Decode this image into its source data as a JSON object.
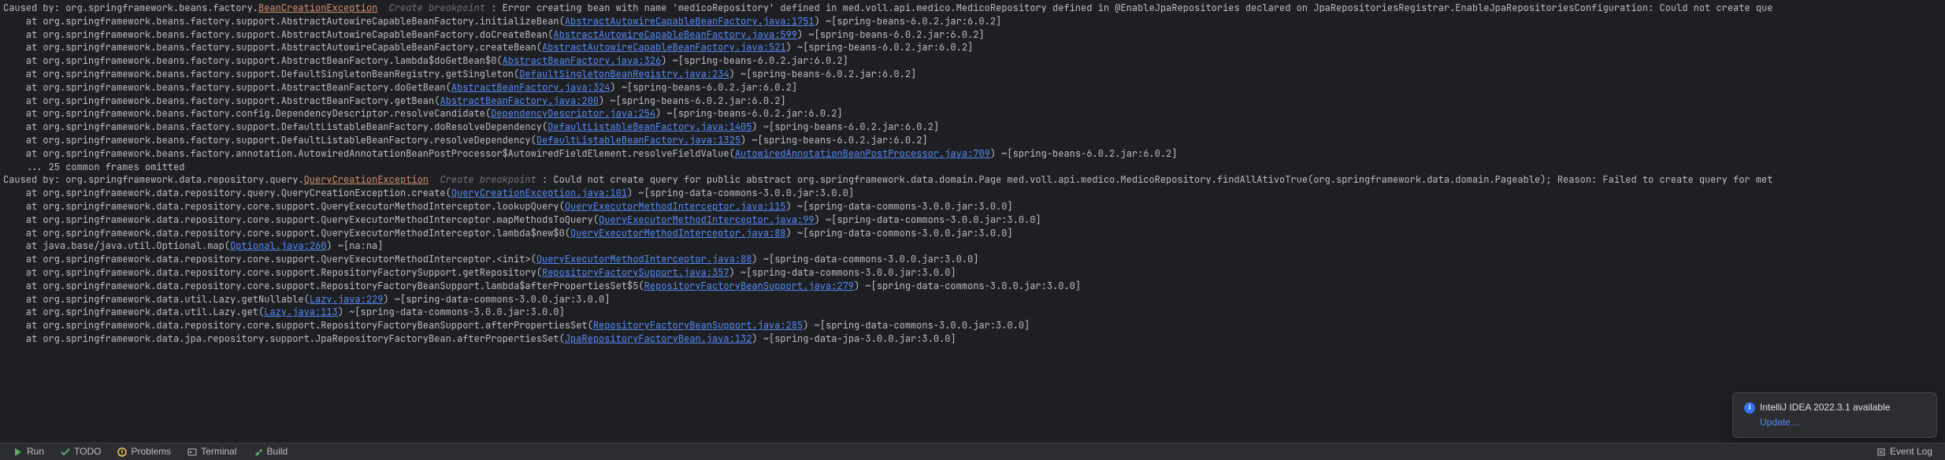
{
  "stack1": {
    "caused_by_prefix": "Caused by: ",
    "caused_by_pkg": "org.springframework.beans.factory.",
    "exception": "BeanCreationException",
    "breakpoint": "Create breakpoint",
    "message_tail": " : Error creating bean with name 'medicoRepository' defined in med.voll.api.medico.MedicoRepository defined in @EnableJpaRepositories declared on JpaRepositoriesRegistrar.EnableJpaRepositoriesConfiguration: Could not create que",
    "frames": [
      {
        "pre": "    at org.springframework.beans.factory.support.AbstractAutowireCapableBeanFactory.initializeBean(",
        "link": "AbstractAutowireCapableBeanFactory.java:1751",
        "post": ") ~[spring-beans-6.0.2.jar:6.0.2]"
      },
      {
        "pre": "    at org.springframework.beans.factory.support.AbstractAutowireCapableBeanFactory.doCreateBean(",
        "link": "AbstractAutowireCapableBeanFactory.java:599",
        "post": ") ~[spring-beans-6.0.2.jar:6.0.2]"
      },
      {
        "pre": "    at org.springframework.beans.factory.support.AbstractAutowireCapableBeanFactory.createBean(",
        "link": "AbstractAutowireCapableBeanFactory.java:521",
        "post": ") ~[spring-beans-6.0.2.jar:6.0.2]"
      },
      {
        "pre": "    at org.springframework.beans.factory.support.AbstractBeanFactory.lambda$doGetBean$0(",
        "link": "AbstractBeanFactory.java:326",
        "post": ") ~[spring-beans-6.0.2.jar:6.0.2]"
      },
      {
        "pre": "    at org.springframework.beans.factory.support.DefaultSingletonBeanRegistry.getSingleton(",
        "link": "DefaultSingletonBeanRegistry.java:234",
        "post": ") ~[spring-beans-6.0.2.jar:6.0.2]"
      },
      {
        "pre": "    at org.springframework.beans.factory.support.AbstractBeanFactory.doGetBean(",
        "link": "AbstractBeanFactory.java:324",
        "post": ") ~[spring-beans-6.0.2.jar:6.0.2]"
      },
      {
        "pre": "    at org.springframework.beans.factory.support.AbstractBeanFactory.getBean(",
        "link": "AbstractBeanFactory.java:200",
        "post": ") ~[spring-beans-6.0.2.jar:6.0.2]"
      },
      {
        "pre": "    at org.springframework.beans.factory.config.DependencyDescriptor.resolveCandidate(",
        "link": "DependencyDescriptor.java:254",
        "post": ") ~[spring-beans-6.0.2.jar:6.0.2]"
      },
      {
        "pre": "    at org.springframework.beans.factory.support.DefaultListableBeanFactory.doResolveDependency(",
        "link": "DefaultListableBeanFactory.java:1405",
        "post": ") ~[spring-beans-6.0.2.jar:6.0.2]"
      },
      {
        "pre": "    at org.springframework.beans.factory.support.DefaultListableBeanFactory.resolveDependency(",
        "link": "DefaultListableBeanFactory.java:1325",
        "post": ") ~[spring-beans-6.0.2.jar:6.0.2]"
      },
      {
        "pre": "    at org.springframework.beans.factory.annotation.AutowiredAnnotationBeanPostProcessor$AutowiredFieldElement.resolveFieldValue(",
        "link": "AutowiredAnnotationBeanPostProcessor.java:709",
        "post": ") ~[spring-beans-6.0.2.jar:6.0.2]"
      }
    ],
    "omitted": "    ... 25 common frames omitted"
  },
  "stack2": {
    "caused_by_prefix": "Caused by: ",
    "caused_by_pkg": "org.springframework.data.repository.query.",
    "exception": "QueryCreationException",
    "breakpoint": "Create breakpoint",
    "message_tail": " : Could not create query for public abstract org.springframework.data.domain.Page med.voll.api.medico.MedicoRepository.findAllAtivoTrue(org.springframework.data.domain.Pageable); Reason: Failed to create query for met",
    "frames": [
      {
        "pre": "    at org.springframework.data.repository.query.QueryCreationException.create(",
        "link": "QueryCreationException.java:101",
        "post": ") ~[spring-data-commons-3.0.0.jar:3.0.0]"
      },
      {
        "pre": "    at org.springframework.data.repository.core.support.QueryExecutorMethodInterceptor.lookupQuery(",
        "link": "QueryExecutorMethodInterceptor.java:115",
        "post": ") ~[spring-data-commons-3.0.0.jar:3.0.0]"
      },
      {
        "pre": "    at org.springframework.data.repository.core.support.QueryExecutorMethodInterceptor.mapMethodsToQuery(",
        "link": "QueryExecutorMethodInterceptor.java:99",
        "post": ") ~[spring-data-commons-3.0.0.jar:3.0.0]"
      },
      {
        "pre": "    at org.springframework.data.repository.core.support.QueryExecutorMethodInterceptor.lambda$new$0(",
        "link": "QueryExecutorMethodInterceptor.java:88",
        "post": ") ~[spring-data-commons-3.0.0.jar:3.0.0]"
      },
      {
        "pre": "    at java.base/java.util.Optional.map(",
        "link": "Optional.java:260",
        "post": ") ~[na:na]"
      },
      {
        "pre": "    at org.springframework.data.repository.core.support.QueryExecutorMethodInterceptor.<init>(",
        "link": "QueryExecutorMethodInterceptor.java:88",
        "post": ") ~[spring-data-commons-3.0.0.jar:3.0.0]"
      },
      {
        "pre": "    at org.springframework.data.repository.core.support.RepositoryFactorySupport.getRepository(",
        "link": "RepositoryFactorySupport.java:357",
        "post": ") ~[spring-data-commons-3.0.0.jar:3.0.0]"
      },
      {
        "pre": "    at org.springframework.data.repository.core.support.RepositoryFactoryBeanSupport.lambda$afterPropertiesSet$5(",
        "link": "RepositoryFactoryBeanSupport.java:279",
        "post": ") ~[spring-data-commons-3.0.0.jar:3.0.0]"
      },
      {
        "pre": "    at org.springframework.data.util.Lazy.getNullable(",
        "link": "Lazy.java:229",
        "post": ") ~[spring-data-commons-3.0.0.jar:3.0.0]"
      },
      {
        "pre": "    at org.springframework.data.util.Lazy.get(",
        "link": "Lazy.java:113",
        "post": ") ~[spring-data-commons-3.0.0.jar:3.0.0]"
      },
      {
        "pre": "    at org.springframework.data.repository.core.support.RepositoryFactoryBeanSupport.afterPropertiesSet(",
        "link": "RepositoryFactoryBeanSupport.java:285",
        "post": ") ~[spring-data-commons-3.0.0.jar:3.0.0]"
      },
      {
        "pre": "    at org.springframework.data.jpa.repository.support.JpaRepositoryFactoryBean.afterPropertiesSet(",
        "link": "JpaRepositoryFactoryBean.java:132",
        "post": ") ~[spring-data-jpa-3.0.0.jar:3.0.0]"
      }
    ]
  },
  "bottom": {
    "run": "Run",
    "todo": "TODO",
    "problems": "Problems",
    "terminal": "Terminal",
    "build": "Build",
    "eventlog": "Event Log"
  },
  "notif": {
    "title": "IntelliJ IDEA 2022.3.1 available",
    "update": "Update…"
  }
}
